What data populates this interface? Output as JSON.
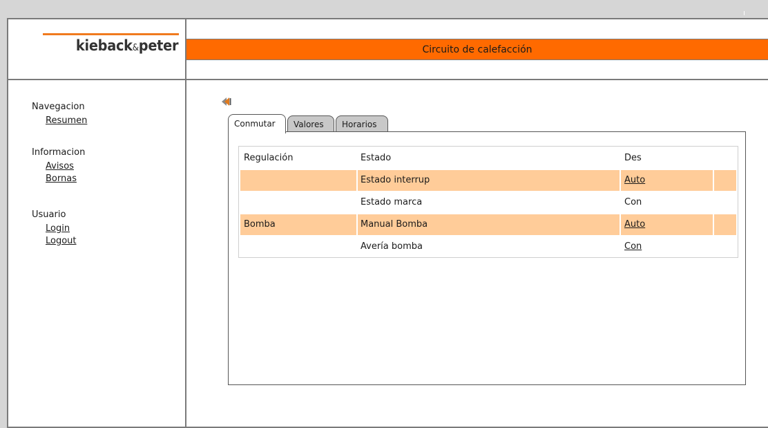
{
  "header": {
    "logo_text": "kieback",
    "logo_amp": "&",
    "logo_text2": "peter",
    "title": "Circuito de calefacción"
  },
  "sidebar": {
    "groups": [
      {
        "heading": "Navegacion",
        "links": [
          "Resumen"
        ]
      },
      {
        "heading": "Informacion",
        "links": [
          "Avisos",
          "Bornas"
        ]
      },
      {
        "heading": "Usuario",
        "links": [
          "Login",
          "Logout"
        ]
      }
    ]
  },
  "content": {
    "back_icon": "rewind-icon",
    "tabs": [
      "Conmutar",
      "Valores",
      "Horarios"
    ],
    "active_tab": "Conmutar",
    "rows": [
      {
        "group": "Regulación",
        "label": "Estado",
        "value": "Des"
      },
      {
        "group": "",
        "label": "Estado interrup",
        "value": "Auto"
      },
      {
        "group": "",
        "label": "Estado marca",
        "value": "Con"
      },
      {
        "group": "Bomba",
        "label": "Manual Bomba",
        "value": "Auto"
      },
      {
        "group": "",
        "label": "Avería bomba",
        "value": "Con"
      }
    ]
  },
  "colors": {
    "accent_orange": "#ff6a00",
    "logo_line": "#f07a1e",
    "row_highlight": "#ffcc99"
  }
}
